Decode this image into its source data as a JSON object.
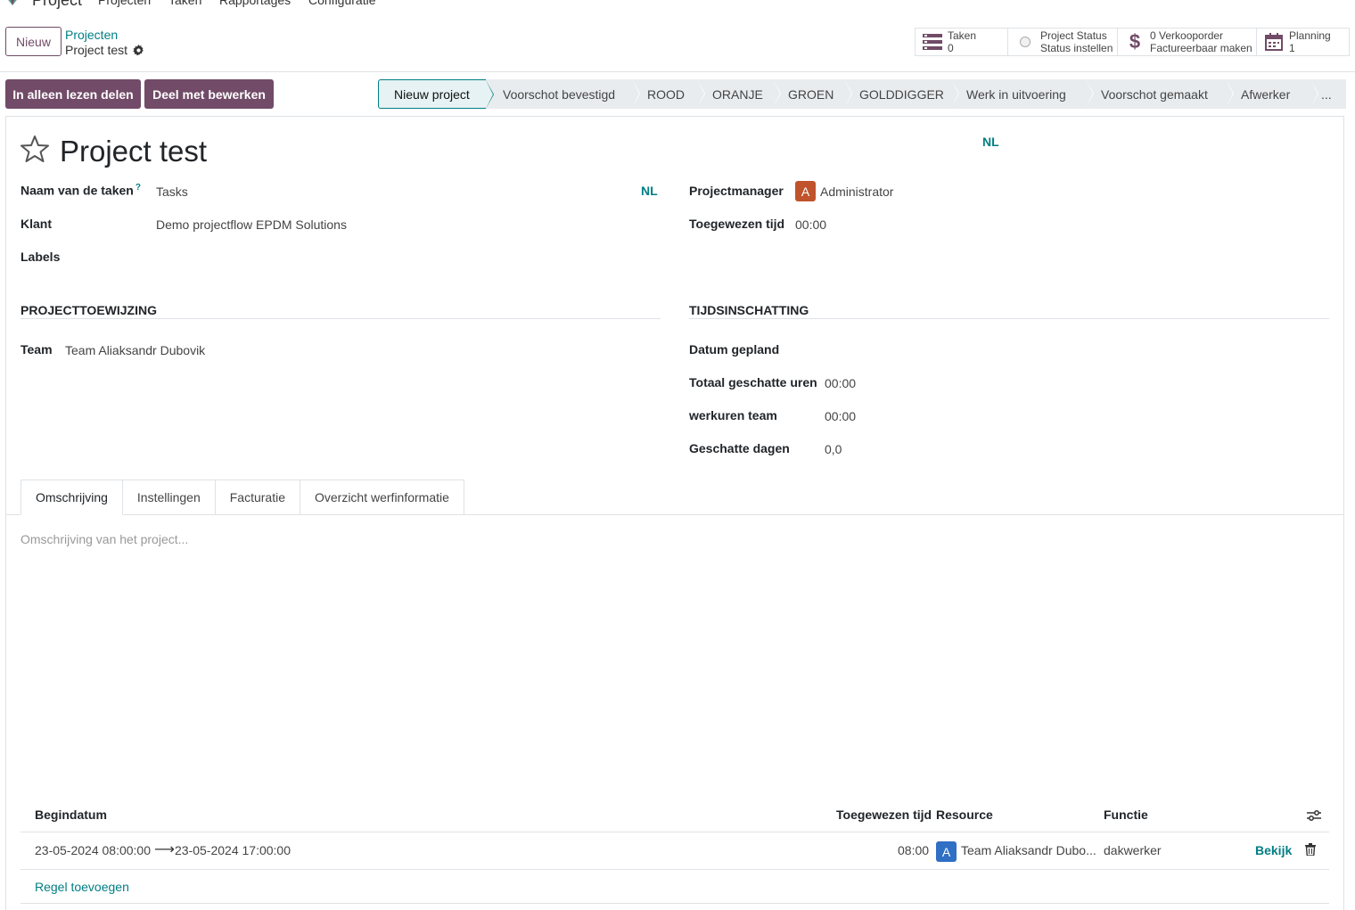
{
  "topnav": {
    "app_name": "Project",
    "menu": [
      "Projecten",
      "Taken",
      "Rapportages",
      "Configuratie"
    ]
  },
  "control": {
    "new_label": "Nieuw",
    "breadcrumb_parent": "Projecten",
    "breadcrumb_current": "Project test",
    "smart_buttons": [
      {
        "icon": "tasks-icon",
        "line1": "Taken",
        "line2": "0"
      },
      {
        "icon": "status-circle-icon",
        "line1": "Project Status",
        "line2": "Status instellen"
      },
      {
        "icon": "dollar-icon",
        "line1": "0 Verkooporder",
        "line2": "Factureerbaar maken"
      },
      {
        "icon": "calendar-icon",
        "line1": "Planning",
        "line2": "1"
      }
    ]
  },
  "actions": {
    "share_readonly": "In alleen lezen delen",
    "share_edit": "Deel met bewerken"
  },
  "stages": [
    "Nieuw project",
    "Voorschot bevestigd",
    "ROOD",
    "ORANJE",
    "GROEN",
    "GOLDDIGGER",
    "Werk in uitvoering",
    "Voorschot gemaakt",
    "Afwerker",
    "..."
  ],
  "form": {
    "title": "Project test",
    "lang_top": "NL",
    "task_name_label": "Naam van de taken",
    "task_name_help": "?",
    "task_name_value": "Tasks",
    "task_name_lang": "NL",
    "customer_label": "Klant",
    "customer_value": "Demo projectflow EPDM Solutions",
    "labels_label": "Labels",
    "manager_label": "Projectmanager",
    "manager_avatar": "A",
    "manager_value": "Administrator",
    "allocated_label": "Toegewezen tijd",
    "allocated_value": "00:00",
    "section_assignment": "PROJECTTOEWIJZING",
    "team_label": "Team",
    "team_value": "Team Aliaksandr Dubovik",
    "section_estimate": "TIJDSINSCHATTING",
    "date_planned_label": "Datum gepland",
    "total_hours_label": "Totaal geschatte uren",
    "total_hours_value": "00:00",
    "team_hours_label": "werkuren team",
    "team_hours_value": "00:00",
    "est_days_label": "Geschatte dagen",
    "est_days_value": "0,0"
  },
  "tabs": [
    "Omschrijving",
    "Instellingen",
    "Facturatie",
    "Overzicht werfinformatie"
  ],
  "description_placeholder": "Omschrijving van het project...",
  "table": {
    "headers": {
      "start": "Begindatum",
      "allocated": "Toegewezen tijd",
      "resource": "Resource",
      "function": "Functie"
    },
    "rows": [
      {
        "start": "23-05-2024 08:00:00",
        "end": "23-05-2024 17:00:00",
        "allocated": "08:00",
        "resource_avatar": "A",
        "resource": "Team Aliaksandr Dubo...",
        "function": "dakwerker",
        "view": "Bekijk"
      }
    ],
    "add_line": "Regel toevoegen"
  },
  "colors": {
    "brand": "#714b67",
    "accent": "#017e84",
    "manager_avatar": "#c0532c",
    "resource_avatar": "#2f6fc4"
  }
}
